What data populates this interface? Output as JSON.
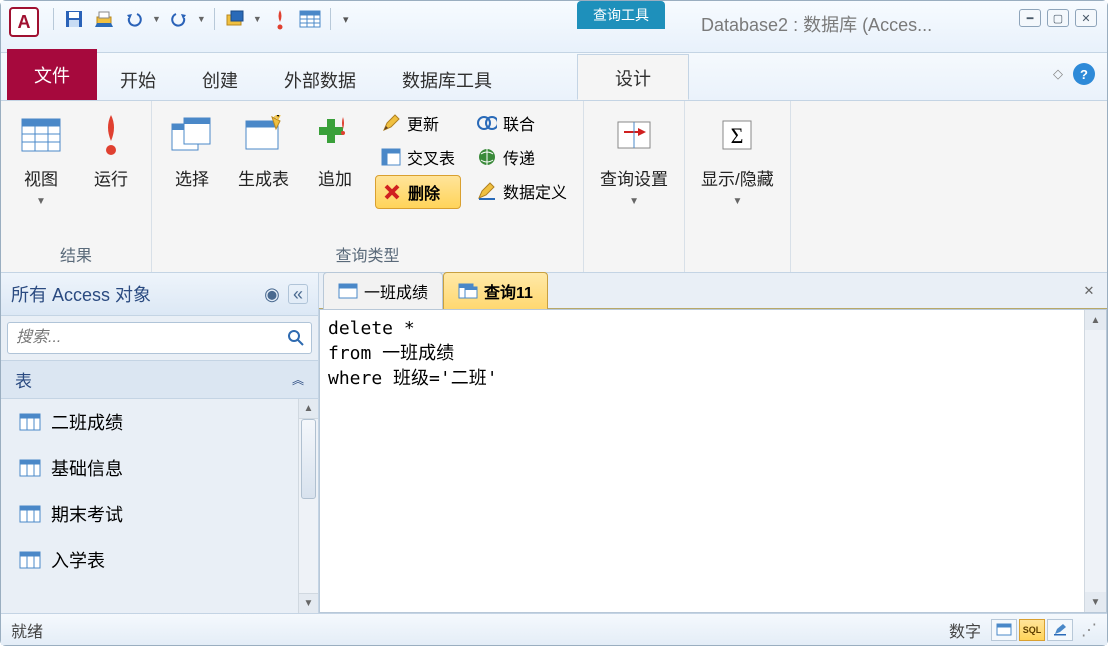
{
  "window": {
    "title": "Database2 : 数据库 (Acces..."
  },
  "context_tool": {
    "header": "查询工具",
    "tab": "设计"
  },
  "tabs": {
    "file": "文件",
    "home": "开始",
    "create": "创建",
    "external": "外部数据",
    "dbtools": "数据库工具"
  },
  "ribbon": {
    "group1": {
      "label": "结果",
      "view": "视图",
      "run": "运行"
    },
    "group2": {
      "label": "查询类型",
      "select": "选择",
      "maketable": "生成表",
      "append": "追加",
      "update": "更新",
      "crosstab": "交叉表",
      "delete": "删除",
      "union": "联合",
      "passthrough": "传递",
      "datadefinition": "数据定义"
    },
    "group3": {
      "label_a": "查询设置",
      "label_b": "显示/隐藏"
    }
  },
  "nav": {
    "title": "所有 Access 对象",
    "search_placeholder": "搜索...",
    "group_tables": "表",
    "items": [
      "二班成绩",
      "基础信息",
      "期末考试",
      "入学表"
    ]
  },
  "doctabs": {
    "tab0": "一班成绩",
    "tab1": "查询11"
  },
  "sql": {
    "text": "delete *\nfrom 一班成绩\nwhere 班级='二班'"
  },
  "status": {
    "left": "就绪",
    "right": "数字",
    "sql_btn": "SQL"
  }
}
